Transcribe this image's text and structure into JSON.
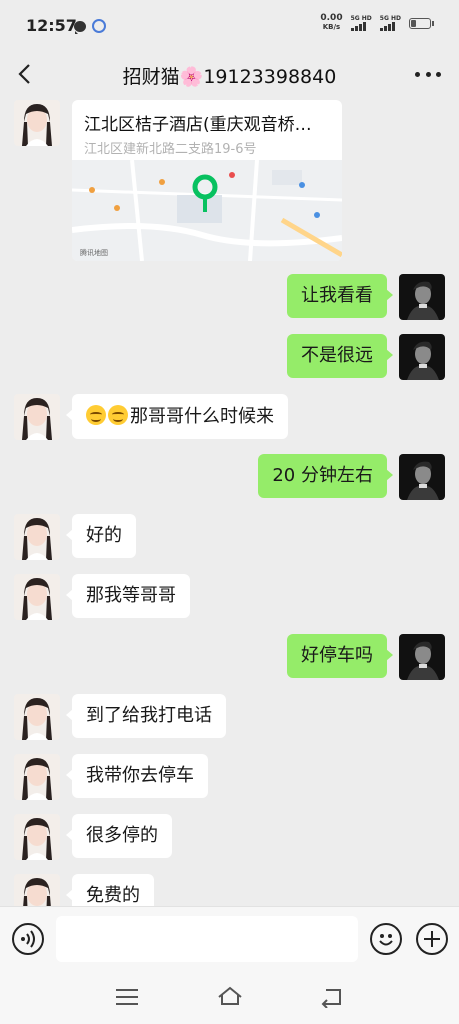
{
  "status_bar": {
    "time": "12:57",
    "net_speed_value": "0.00",
    "net_speed_unit": "KB/s",
    "signal1_label": "5G HD",
    "signal2_label": "5G HD",
    "battery_level": 0.3
  },
  "header": {
    "title": "招财猫🌸19123398840"
  },
  "location_card": {
    "name": "江北区桔子酒店(重庆观音桥…",
    "address": "江北区建新北路二支路19-6号",
    "map_brand": "腾讯地图"
  },
  "messages": [
    {
      "side": "right",
      "text": "让我看看"
    },
    {
      "side": "right",
      "text": "不是很远"
    },
    {
      "side": "left",
      "text": "那哥哥什么时候来",
      "emoji_count": 2
    },
    {
      "side": "right",
      "text": "20 分钟左右"
    },
    {
      "side": "left",
      "text": "好的"
    },
    {
      "side": "left",
      "text": "那我等哥哥"
    },
    {
      "side": "right",
      "text": "好停车吗"
    },
    {
      "side": "left",
      "text": "到了给我打电话"
    },
    {
      "side": "left",
      "text": "我带你去停车"
    },
    {
      "side": "left",
      "text": "很多停的"
    },
    {
      "side": "left",
      "text": "免费的"
    }
  ],
  "colors": {
    "background": "#ededed",
    "sent_bubble": "#95ec69",
    "received_bubble": "#ffffff",
    "map_pin": "#07c160"
  },
  "icons": {
    "back": "chevron-left-icon",
    "more": "ellipsis-icon",
    "voice": "voice-icon",
    "emoji": "smiley-icon",
    "plus": "plus-icon"
  }
}
